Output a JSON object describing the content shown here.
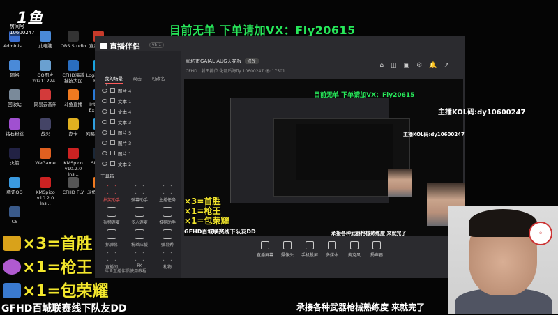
{
  "overlay": {
    "top_title": "目前无单  下单请加VX：Fly20615",
    "kol_text": "主播KOL码:dy10600247",
    "kol_text_small": "主播KOL码:dy10600247",
    "room_label": "房间号",
    "room_id": "10600247",
    "logo_text": "1鱼",
    "awards": [
      "×3=首胜",
      "×1=枪王",
      "×1=包荣耀"
    ],
    "bottom_left": "GFHD百城联赛线下队友DD",
    "bottom_right": "承接各种武器枪械熟练度  来就完了"
  },
  "desktop": {
    "icons": [
      {
        "label": "Adminis...",
        "color": "#3b6fd1"
      },
      {
        "label": "此电脑",
        "color": "#4a8ad8"
      },
      {
        "label": "OBS Studio",
        "color": "#333333"
      },
      {
        "label": "穿越火线",
        "color": "#c73a2a"
      },
      {
        "label": "网络",
        "color": "#4a8ad8"
      },
      {
        "label": "QQ图片 20211224...",
        "color": "#6aa0d0"
      },
      {
        "label": "CFHD海道 挂技大区",
        "color": "#2a6ec0"
      },
      {
        "label": "Logitech G HUB",
        "color": "#1aa4e0"
      },
      {
        "label": "回收站",
        "color": "#7a8a9a"
      },
      {
        "label": "网易云音乐",
        "color": "#d33a3a"
      },
      {
        "label": "斗鱼直播",
        "color": "#f07a20"
      },
      {
        "label": "Internet Explorer",
        "color": "#2a7ad8"
      },
      {
        "label": "钻石粉丝",
        "color": "#a050d0"
      },
      {
        "label": "战火",
        "color": "#444466"
      },
      {
        "label": "办卡",
        "color": "#e0b020"
      },
      {
        "label": "网易UU加速器",
        "color": "#30a0e0"
      },
      {
        "label": "火箭",
        "color": "#222244"
      },
      {
        "label": "WeGame",
        "color": "#e06020"
      },
      {
        "label": "KMSpico v10.2.0 Ins...",
        "color": "#cc2222"
      },
      {
        "label": "Steam",
        "color": "#1b2838"
      },
      {
        "label": "腾讯QQ",
        "color": "#3a9ae0"
      },
      {
        "label": "KMSpico v10.2.0 Ins...",
        "color": "#cc2222"
      },
      {
        "label": "CFHD FLY",
        "color": "#555555"
      },
      {
        "label": "斗鱼直播伴侣",
        "color": "#f07a20"
      },
      {
        "label": "CS",
        "color": "#3a5a8a"
      }
    ]
  },
  "app": {
    "logo": "直播伴侣",
    "version": "v5.1",
    "scene_tabs": [
      "我的场景",
      "双击",
      "可改名"
    ],
    "scenes": [
      "图片 4",
      "文本 1",
      "文本 4",
      "文本 3",
      "图片 5",
      "图片 3",
      "图片 1",
      "文本 2"
    ],
    "tools_title": "工具箱",
    "tools": [
      "抽奖助手",
      "弹幕助手",
      "主播任务",
      "视频连麦",
      "多人连麦",
      "推荐助手",
      "抓弹幕",
      "粉丝应援",
      "弹幕秀",
      "直播间",
      "PK",
      "礼物"
    ],
    "location": "廊坊市GAIAL AUG天花板",
    "location_chip": "修改",
    "stream_info": "CFHD · 射王排位  化部后海fly  10600247",
    "viewer_count": "17501",
    "top_icons": [
      "⌂",
      "◫",
      "▣",
      "⚙",
      "🔔",
      "↗"
    ],
    "bottom_buttons": [
      "直播屏幕",
      "摄像头",
      "手机投屏",
      "多媒体",
      "麦克风",
      "扬声器"
    ],
    "tip": "斗鱼直播伴侣使用教程"
  }
}
